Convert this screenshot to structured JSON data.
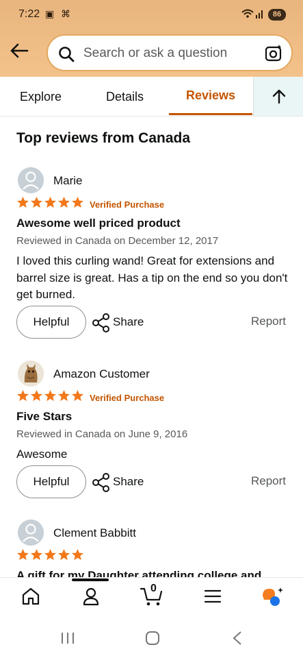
{
  "status_bar": {
    "time": "7:22",
    "battery": "86"
  },
  "search": {
    "placeholder": "Search or ask a question"
  },
  "tabs": [
    {
      "label": "Explore"
    },
    {
      "label": "Details"
    },
    {
      "label": "Reviews",
      "active": true
    }
  ],
  "section_title": "Top reviews from Canada",
  "reviews": [
    {
      "author": "Marie",
      "rating": 5,
      "verified": "Verified Purchase",
      "title": "Awesome well priced product",
      "date": "Reviewed in Canada on December 12, 2017",
      "body": "I loved this curling wand! Great for extensions and barrel size is great. Has a tip on the end so you don't get burned.",
      "helpful": "Helpful",
      "share": "Share",
      "report": "Report"
    },
    {
      "author": "Amazon Customer",
      "rating": 5,
      "verified": "Verified Purchase",
      "title": "Five Stars",
      "date": "Reviewed in Canada on June 9, 2016",
      "body": "Awesome",
      "helpful": "Helpful",
      "share": "Share",
      "report": "Report"
    },
    {
      "author": "Clement Babbitt",
      "rating": 5,
      "title": "A gift for my Daughter attending college and"
    }
  ],
  "bottom_nav": {
    "cart_count": "0",
    "items": [
      "home-icon",
      "account-icon",
      "cart-icon",
      "menu-icon",
      "rufus-icon"
    ]
  },
  "colors": {
    "accent": "#c45500",
    "star": "#f3781a",
    "header": "#f3c28a"
  }
}
